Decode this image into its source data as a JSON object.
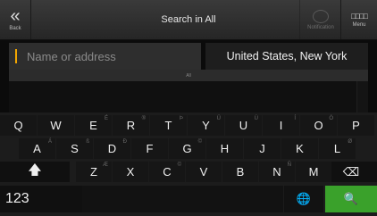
{
  "header": {
    "back_label": "Back",
    "title": "Search in All",
    "notif_label": "Notification",
    "menu_label": "Menu"
  },
  "search": {
    "placeholder": "Name or address",
    "country": "United States, New York"
  },
  "results": {
    "handle_label": "All"
  },
  "keyboard": {
    "row1": [
      {
        "key": "Q",
        "alt": ""
      },
      {
        "key": "W",
        "alt": ""
      },
      {
        "key": "E",
        "alt": "É"
      },
      {
        "key": "R",
        "alt": "®"
      },
      {
        "key": "T",
        "alt": "Þ"
      },
      {
        "key": "Y",
        "alt": "Ü"
      },
      {
        "key": "U",
        "alt": "Ú"
      },
      {
        "key": "I",
        "alt": "Í"
      },
      {
        "key": "O",
        "alt": "Ó"
      },
      {
        "key": "P",
        "alt": ""
      }
    ],
    "row2": [
      {
        "key": "A",
        "alt": "Á"
      },
      {
        "key": "S",
        "alt": "ß"
      },
      {
        "key": "D",
        "alt": "Ð"
      },
      {
        "key": "F",
        "alt": ""
      },
      {
        "key": "G",
        "alt": "©"
      },
      {
        "key": "H",
        "alt": ""
      },
      {
        "key": "J",
        "alt": ""
      },
      {
        "key": "K",
        "alt": ""
      },
      {
        "key": "L",
        "alt": "Ø"
      }
    ],
    "row3": [
      {
        "key": "Z",
        "alt": "Æ"
      },
      {
        "key": "X",
        "alt": ""
      },
      {
        "key": "C",
        "alt": "©"
      },
      {
        "key": "V",
        "alt": ""
      },
      {
        "key": "B",
        "alt": ""
      },
      {
        "key": "N",
        "alt": "Ñ"
      },
      {
        "key": "M",
        "alt": ""
      }
    ],
    "shift_glyph": "🡅",
    "backspace_glyph": "⌫",
    "numbers_label": "123",
    "globe_glyph": "🌐",
    "search_glyph": "🔍",
    "icons": {
      "back": "back-chevron-icon",
      "notification": "speech-bubble-icon",
      "menu": "grid-menu-icon",
      "shift": "shift-arrow-icon",
      "backspace": "backspace-icon",
      "globe": "globe-icon",
      "search": "magnifier-icon"
    },
    "accent_color": "#3aa12b"
  }
}
